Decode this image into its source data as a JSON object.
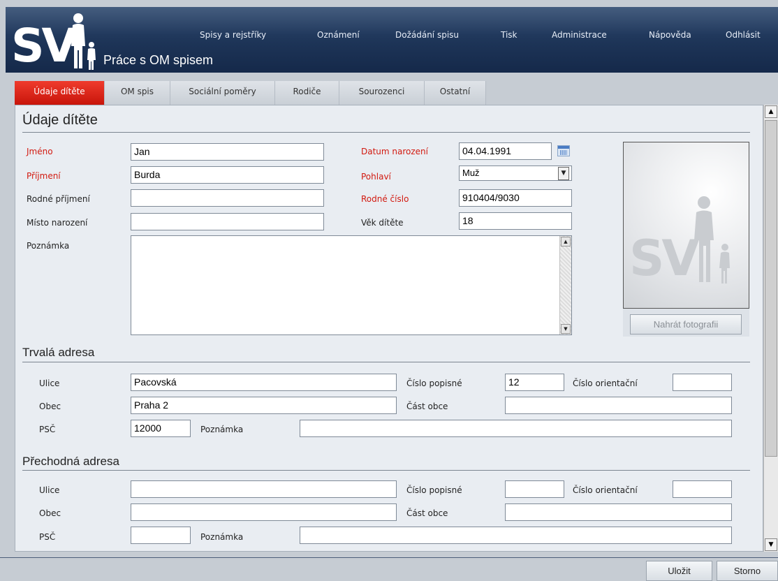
{
  "header": {
    "logo_text": "SV",
    "page_heading": "Práce s OM spisem",
    "nav": [
      "Spisy a rejstříky",
      "Oznámení",
      "Dožádání spisu",
      "Tisk",
      "Administrace",
      "Nápověda",
      "Odhlásit"
    ]
  },
  "tabs": [
    "Údaje dítěte",
    "OM spis",
    "Sociální poměry",
    "Rodiče",
    "Sourozenci",
    "Ostatní"
  ],
  "active_tab": "Údaje dítěte",
  "child": {
    "section_title": "Údaje dítěte",
    "jmeno_label": "Jméno",
    "jmeno": "Jan",
    "prijmeni_label": "Příjmení",
    "prijmeni": "Burda",
    "rodne_prijmeni_label": "Rodné příjmení",
    "rodne_prijmeni": "",
    "misto_narozeni_label": "Místo narození",
    "misto_narozeni": "",
    "poznamka_label": "Poznámka",
    "poznamka": "",
    "datum_narozeni_label": "Datum narození",
    "datum_narozeni": "04.04.1991",
    "pohlavi_label": "Pohlaví",
    "pohlavi": "Muž",
    "rodne_cislo_label": "Rodné číslo",
    "rodne_cislo": "910404/9030",
    "vek_label": "Věk dítěte",
    "vek": "18",
    "upload_photo": "Nahrát fotografii"
  },
  "trvala": {
    "section_title": "Trvalá adresa",
    "ulice_label": "Ulice",
    "ulice": "Pacovská",
    "obec_label": "Obec",
    "obec": "Praha 2",
    "psc_label": "PSČ",
    "psc": "12000",
    "poznamka_label": "Poznámka",
    "poznamka": "",
    "cislo_popisne_label": "Číslo popisné",
    "cislo_popisne": "12",
    "cislo_orientacni_label": "Číslo orientační",
    "cislo_orientacni": "",
    "cast_obce_label": "Část obce",
    "cast_obce": ""
  },
  "prechodna": {
    "section_title": "Přechodná adresa",
    "ulice_label": "Ulice",
    "ulice": "",
    "obec_label": "Obec",
    "obec": "",
    "psc_label": "PSČ",
    "psc": "",
    "poznamka_label": "Poznámka",
    "poznamka": "",
    "cislo_popisne_label": "Číslo popisné",
    "cislo_popisne": "",
    "cislo_orientacni_label": "Číslo orientační",
    "cislo_orientacni": "",
    "cast_obce_label": "Část obce",
    "cast_obce": ""
  },
  "actions": {
    "save": "Uložit",
    "cancel": "Storno"
  },
  "colors": {
    "header": "#1d3457",
    "active_tab": "#e0261b",
    "required_label": "#d21a10",
    "panel": "#e9edf2"
  }
}
